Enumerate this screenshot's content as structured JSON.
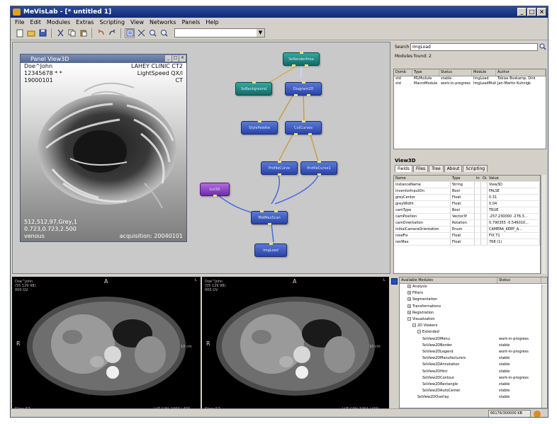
{
  "window": {
    "title": "MeVisLab - [* untitled 1]",
    "btn_min": "_",
    "btn_max": "□",
    "btn_close": "×"
  },
  "menu": [
    "File",
    "Edit",
    "Modules",
    "Extras",
    "Scripting",
    "View",
    "Networks",
    "Panels",
    "Help"
  ],
  "toolbar": {
    "combo_arrow": "▼"
  },
  "view3d": {
    "title": "Panel View3D",
    "patient_name": "Doe^John",
    "patient_id": "12345678 * *",
    "birth_date": "19000101",
    "institution": "LAHEY CLINIC CT2",
    "scanner": "LightSpeed QX/i",
    "modality": "CT",
    "coords1": "512,512,97,Grey,1",
    "coords2": "0.723,0.723,2.500",
    "series": "venous",
    "acquisition": "acquisition: 20040101"
  },
  "nodes": {
    "so_render": "SoRenderArea",
    "so_background": "SoBackground",
    "diagram": "Diagram2D",
    "style_palette": "StylePalette",
    "cut_curves": "CutCurves",
    "profile_a": "ProfileCurve",
    "profile_b": "ProfileCurve1",
    "lut": "Lut3D",
    "max_scan": "MidMaxScan",
    "img_load": "ImgLoad"
  },
  "search": {
    "label": "Search",
    "value": "ImgLoad",
    "found": "Modules found: 2"
  },
  "modules_table": {
    "headers": [
      "Domb",
      "Type",
      "Status",
      "Module",
      "Author"
    ],
    "rows": [
      [
        "std",
        "MLModule",
        "stable",
        "ImgLoad",
        "Tobias Boskamp, Dirk"
      ],
      [
        "std",
        "MacroModule",
        "work-in-progress",
        "ImgLoadMulti",
        "Jan-Martin Kuhnigk"
      ]
    ]
  },
  "props": {
    "title": "View3D",
    "tabs": [
      "Fields",
      "Files",
      "Tree",
      "About",
      "Scripting"
    ],
    "headers": [
      "Name",
      "Type",
      "In",
      "Ou",
      "Value"
    ],
    "rows": [
      [
        "instanceName",
        "String",
        "View3D"
      ],
      [
        "inventorInputOn",
        "Bool",
        "FALSE"
      ],
      [
        "greyCenter",
        "Float",
        "0.31"
      ],
      [
        "greyWidth",
        "Float",
        "0.04"
      ],
      [
        "camType",
        "Bool",
        "TRUE"
      ],
      [
        "camPosition",
        "Vector3f",
        "-257.230000 -276.3..."
      ],
      [
        "camOrientation",
        "Rotation",
        "0.790355 -0.546010..."
      ],
      [
        "initialCameraOrientation",
        "Enum",
        "CAMERA_KEEP_A..."
      ],
      [
        "roseFix",
        "Float",
        "FIX T1"
      ],
      [
        "renMax",
        "Float",
        "768 (1)"
      ]
    ]
  },
  "ct_left": {
    "name": "Doe^John",
    "line2": "(55 129 98)",
    "line3": "000 GV",
    "top": "A",
    "left": "R",
    "right": "L",
    "scale": "10 cm",
    "slice": "Slice: 57",
    "lut": "LUT C/W: 1064 / 400"
  },
  "ct_right": {
    "name": "Doe^John",
    "line2": "(55 129 98)",
    "line3": "000 GV",
    "top": "A",
    "left": "R",
    "right": "L",
    "scale": "10 cm",
    "slice": "Slice: 57",
    "lut": "LUT C/W: 1064 / 400"
  },
  "tree": {
    "headers": [
      "Available Modules",
      "Status"
    ],
    "items": [
      {
        "label": "Analysis",
        "indent": 1,
        "box": "+"
      },
      {
        "label": "Filters",
        "indent": 1,
        "box": "+"
      },
      {
        "label": "Segmentation",
        "indent": 1,
        "box": "+"
      },
      {
        "label": "Transformations",
        "indent": 1,
        "box": "+"
      },
      {
        "label": "Registration",
        "indent": 1,
        "box": "+"
      },
      {
        "label": "Visualization",
        "indent": 1,
        "box": "−"
      },
      {
        "label": "2D Viewers",
        "indent": 2,
        "box": "−"
      },
      {
        "label": "Extended",
        "indent": 3,
        "box": "−"
      },
      {
        "label": "SoView2DMenu",
        "indent": 4,
        "box": "",
        "status": "work-in-progress"
      },
      {
        "label": "SoView2DBorder",
        "indent": 4,
        "box": "",
        "status": "stable"
      },
      {
        "label": "SoView2DLegend",
        "indent": 4,
        "box": "",
        "status": "work-in-progress"
      },
      {
        "label": "SoView2DManufacturers",
        "indent": 4,
        "box": "",
        "status": "stable"
      },
      {
        "label": "SoView2DAnnotation",
        "indent": 4,
        "box": "",
        "status": "stable"
      },
      {
        "label": "SoView2DHint",
        "indent": 4,
        "box": "",
        "status": "stable"
      },
      {
        "label": "SoView2DContour",
        "indent": 4,
        "box": "",
        "status": "work-in-progress"
      },
      {
        "label": "SoView2DRectangle",
        "indent": 4,
        "box": "",
        "status": "stable"
      },
      {
        "label": "SoView2DAutoCenter",
        "indent": 4,
        "box": "",
        "status": "stable"
      },
      {
        "label": "SoView2DOverlay",
        "indent": 3,
        "box": "",
        "status": "stable"
      }
    ]
  },
  "status": {
    "memory": "66176/300000 KB"
  }
}
